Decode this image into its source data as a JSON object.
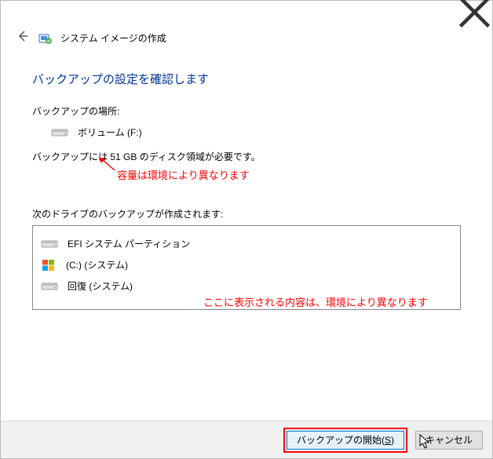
{
  "window": {
    "title": "システム イメージの作成"
  },
  "main": {
    "heading": "バックアップの設定を確認します",
    "location_label": "バックアップの場所:",
    "location_value": "ボリューム (F:)",
    "size_prefix": "バックアップには ",
    "size_value": "51 GB",
    "size_suffix": " のディスク領域が必要です。",
    "drives_label": "次のドライブのバックアップが作成されます:",
    "drives": [
      {
        "name": "EFI システム パーティション",
        "icon": "hdd"
      },
      {
        "name": "(C:) (システム)",
        "icon": "windows"
      },
      {
        "name": "回復 (システム)",
        "icon": "hdd"
      }
    ]
  },
  "annotations": {
    "size_note": "容量は環境により異なります",
    "drives_note": "ここに表示される内容は、環境により異なります"
  },
  "footer": {
    "start_label": "バックアップの開始(",
    "start_key": "S",
    "start_suffix": ")",
    "cancel_label": "キャンセル"
  }
}
